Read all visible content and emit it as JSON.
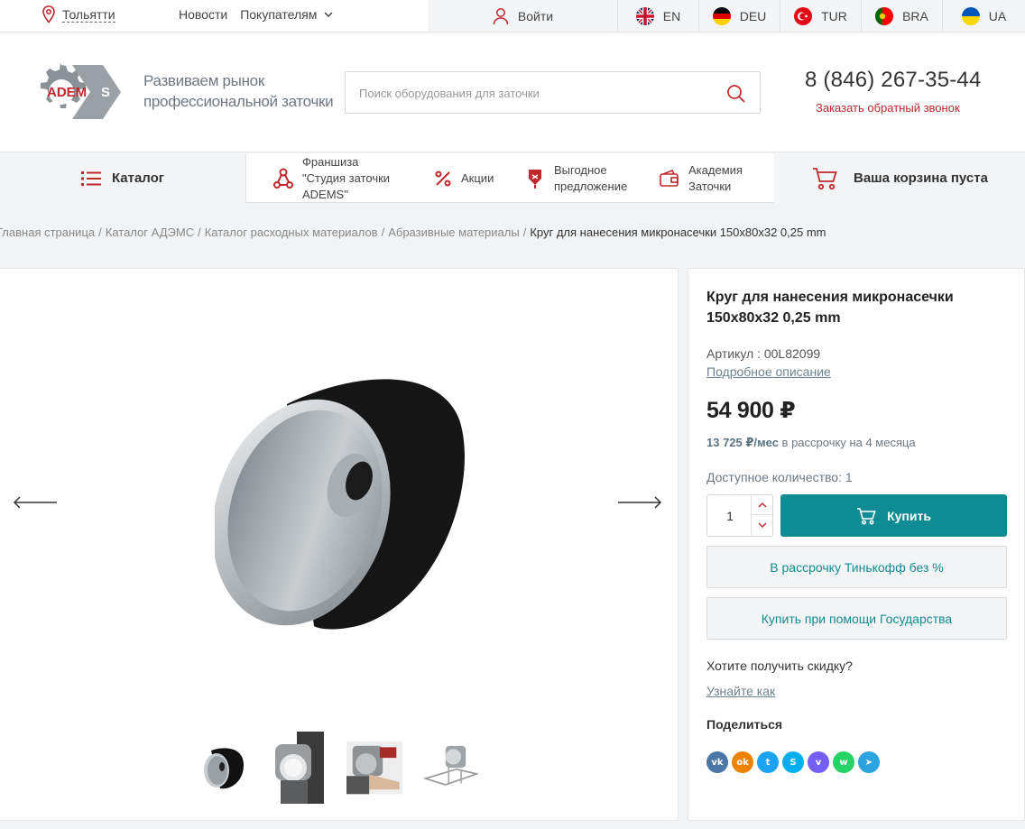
{
  "topbar": {
    "city": "Тольятти",
    "nav": [
      "Новости",
      "Покупателям"
    ],
    "login": "Войти",
    "languages": [
      {
        "code": "EN",
        "flag": "uk-flag-icon"
      },
      {
        "code": "DEU",
        "flag": "germany-flag-icon"
      },
      {
        "code": "TUR",
        "flag": "turkey-flag-icon"
      },
      {
        "code": "BRA",
        "flag": "portugal-flag-icon"
      },
      {
        "code": "UA",
        "flag": "ukraine-flag-icon"
      }
    ]
  },
  "header": {
    "logo_text": "ADEMS",
    "slogan_line1": "Развиваем рынок",
    "slogan_line2": "профессиональной заточки",
    "search_placeholder": "Поиск оборудования для заточки",
    "phone": "8 (846) 267-35-44",
    "callback": "Заказать обратный звонок"
  },
  "menu": {
    "catalog": "Каталог",
    "franchise_l1": "Франшиза",
    "franchise_l2": "\"Студия заточки",
    "franchise_l3": "ADEMS\"",
    "promo": "Акции",
    "offer_l1": "Выгодное",
    "offer_l2": "предложение",
    "academy_l1": "Академия",
    "academy_l2": "Заточки",
    "cart": "Ваша корзина пуста"
  },
  "breadcrumb": {
    "items": [
      "Главная страница",
      "Каталог АДЭМС",
      "Каталог расходных материалов",
      "Абразивные материалы"
    ],
    "current": "Круг для нанесения микронасечки 150х80х32 0,25 mm"
  },
  "product": {
    "title": "Круг для нанесения микронасечки 150х80х32 0,25 mm",
    "sku": "Артикул : 00L82099",
    "details_link": "Подробное описание",
    "price": "54 900 ₽",
    "installment_amount": "13 725 ₽/мес",
    "installment_text": " в рассрочку на 4 месяца",
    "available": "Доступное количество: 1",
    "quantity": "1",
    "buy_label": "Купить",
    "tinkoff_label": "В рассрочку Тинькофф без %",
    "gov_label": "Купить при помощи Государства",
    "discount_question": "Хотите получить скидку?",
    "learn_how": "Узнайте как",
    "share_label": "Поделиться"
  },
  "socials": [
    {
      "icon": "vk-icon",
      "color": "#4a76a8",
      "glyph": "vk"
    },
    {
      "icon": "odnoklassniki-icon",
      "color": "#ee8208",
      "glyph": "ok"
    },
    {
      "icon": "twitter-icon",
      "color": "#1da1f2",
      "glyph": "t"
    },
    {
      "icon": "skype-icon",
      "color": "#00aff0",
      "glyph": "S"
    },
    {
      "icon": "viber-icon",
      "color": "#7360f2",
      "glyph": "v"
    },
    {
      "icon": "whatsapp-icon",
      "color": "#25d366",
      "glyph": "w"
    },
    {
      "icon": "telegram-icon",
      "color": "#2aa3df",
      "glyph": "➤"
    }
  ],
  "colors": {
    "accent": "#0f8b93",
    "brand_red": "#c0282d"
  }
}
